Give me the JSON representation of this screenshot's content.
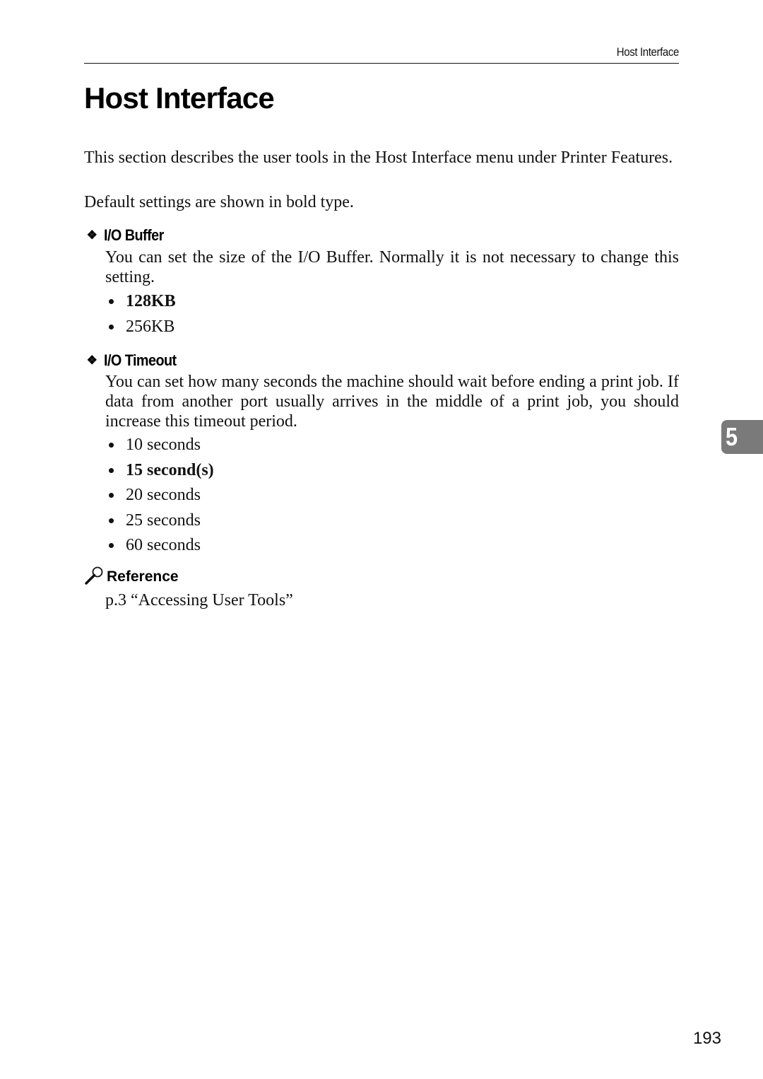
{
  "running_header": "Host Interface",
  "page_title": "Host Interface",
  "intro": {
    "paragraph1": "This section describes the user tools in the Host Interface menu under Printer Features.",
    "paragraph2": "Default settings are shown in bold type."
  },
  "sections": [
    {
      "icon": "diamond-bullet-icon",
      "heading": "I/O Buffer",
      "body": "You can set the size of the I/O Buffer. Normally it is not necessary to change this setting.",
      "options": [
        {
          "label": "128KB",
          "default": true
        },
        {
          "label": "256KB",
          "default": false
        }
      ]
    },
    {
      "icon": "diamond-bullet-icon",
      "heading": "I/O Timeout",
      "body": "You can set how many seconds the machine should wait before ending a print job. If data from another port usually arrives in the middle of a print job, you should increase this timeout period.",
      "options": [
        {
          "label": "10 seconds",
          "default": false
        },
        {
          "label": "15 second(s)",
          "default": true
        },
        {
          "label": "20 seconds",
          "default": false
        },
        {
          "label": "25 seconds",
          "default": false
        },
        {
          "label": "60 seconds",
          "default": false
        }
      ]
    }
  ],
  "reference": {
    "icon": "magnifier-icon",
    "heading": "Reference",
    "text": "p.3 “Accessing User Tools”"
  },
  "chapter_tab": "5",
  "page_number": "193",
  "colors": {
    "text": "#111111",
    "chapter_tab_bg": "#7a7a7a",
    "chapter_tab_text": "#ffffff"
  }
}
